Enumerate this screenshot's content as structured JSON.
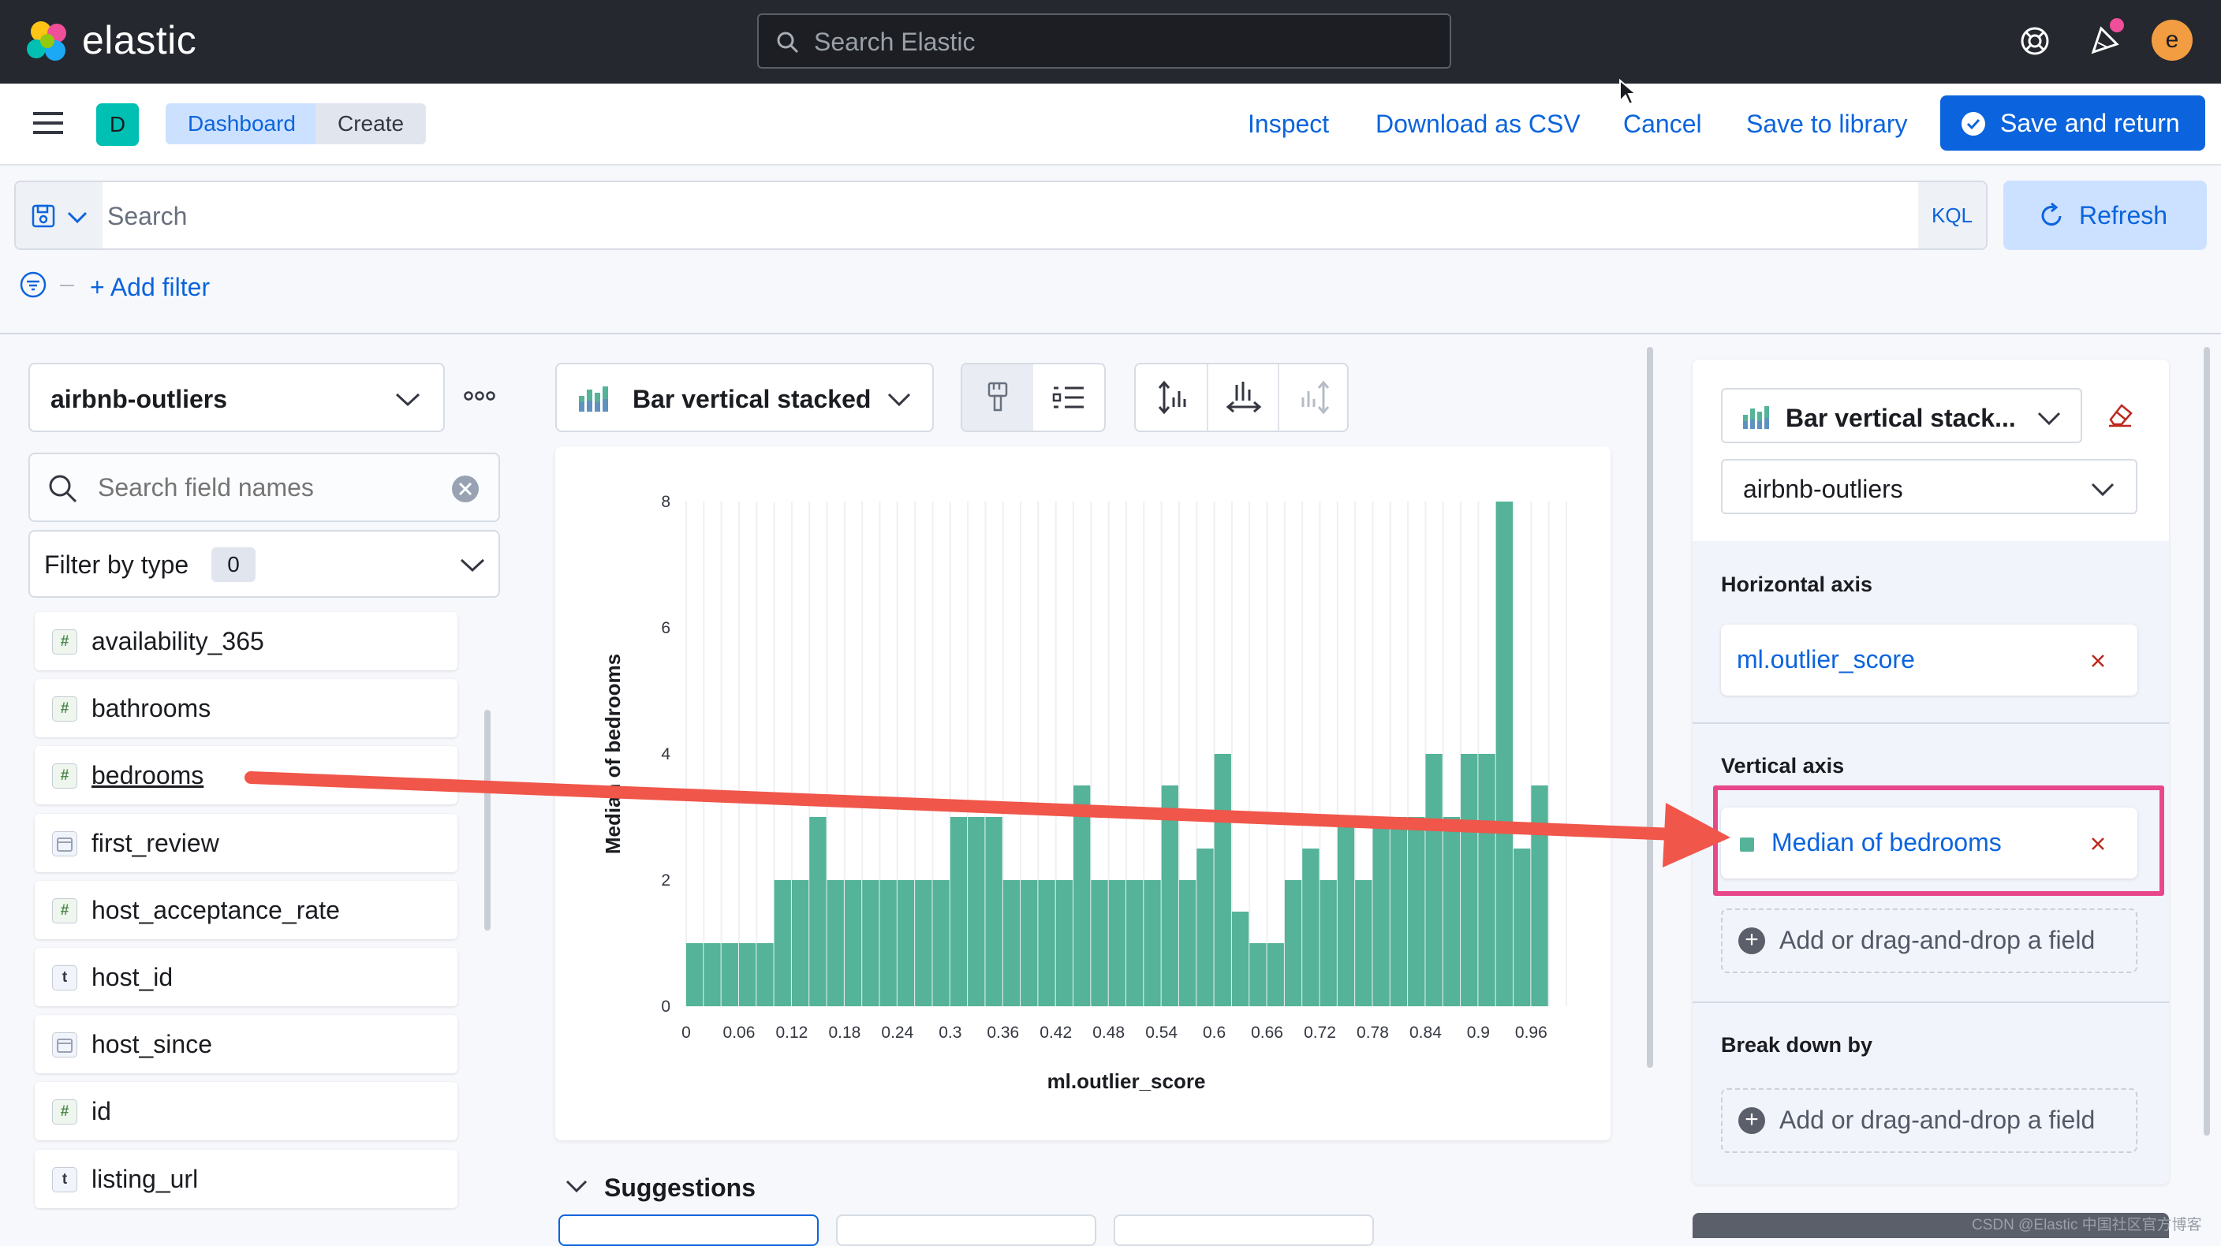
{
  "app": {
    "logo_text": "elastic",
    "user_initial": "e"
  },
  "global_search": {
    "placeholder": "Search Elastic"
  },
  "header": {
    "space_badge": "D",
    "breadcrumbs": [
      "Dashboard",
      "Create"
    ],
    "links": {
      "inspect": "Inspect",
      "download_csv": "Download as CSV",
      "cancel": "Cancel",
      "save_library": "Save to library"
    },
    "save_return": "Save and return"
  },
  "query": {
    "placeholder": "Search",
    "language": "KQL",
    "refresh": "Refresh",
    "add_filter": "+ Add filter"
  },
  "left_panel": {
    "index_pattern": "airbnb-outliers",
    "field_search_placeholder": "Search field names",
    "filter_by_type": "Filter by type",
    "filter_count": "0",
    "fields": [
      {
        "name": "availability_365",
        "type": "#"
      },
      {
        "name": "bathrooms",
        "type": "#"
      },
      {
        "name": "bedrooms",
        "type": "#"
      },
      {
        "name": "first_review",
        "type": "date"
      },
      {
        "name": "host_acceptance_rate",
        "type": "#"
      },
      {
        "name": "host_id",
        "type": "t"
      },
      {
        "name": "host_since",
        "type": "date"
      },
      {
        "name": "id",
        "type": "#"
      },
      {
        "name": "listing_url",
        "type": "t"
      }
    ]
  },
  "workspace": {
    "chart_type": "Bar vertical stacked",
    "suggestions": "Suggestions"
  },
  "right_panel": {
    "chart_type": "Bar vertical stack...",
    "index_pattern": "airbnb-outliers",
    "horizontal_axis_title": "Horizontal axis",
    "horizontal_field": "ml.outlier_score",
    "vertical_axis_title": "Vertical axis",
    "vertical_field": "Median of bedrooms",
    "add_field": "Add or drag-and-drop a field",
    "break_down_title": "Break down by"
  },
  "watermark": "CSDN @Elastic 中国社区官方博客",
  "colors": {
    "accent": "#0b64dd",
    "bar": "#54b399",
    "topbar": "#25282f",
    "highlight": "#e8488b",
    "arrow": "#f0564a"
  },
  "chart_data": {
    "type": "bar",
    "xlabel": "ml.outlier_score",
    "ylabel": "Median of bedrooms",
    "ylim": [
      0,
      8
    ],
    "xlim": [
      0,
      1
    ],
    "bin_width": 0.02,
    "x_ticks": [
      "0",
      "0.06",
      "0.12",
      "0.18",
      "0.24",
      "0.3",
      "0.36",
      "0.42",
      "0.48",
      "0.54",
      "0.6",
      "0.66",
      "0.72",
      "0.78",
      "0.84",
      "0.9",
      "0.96"
    ],
    "y_ticks": [
      "0",
      "2",
      "4",
      "6",
      "8"
    ],
    "x": [
      0,
      0.02,
      0.04,
      0.06,
      0.08,
      0.1,
      0.12,
      0.14,
      0.16,
      0.18,
      0.2,
      0.22,
      0.24,
      0.26,
      0.28,
      0.3,
      0.32,
      0.34,
      0.36,
      0.38,
      0.4,
      0.42,
      0.44,
      0.46,
      0.48,
      0.5,
      0.52,
      0.54,
      0.56,
      0.58,
      0.6,
      0.62,
      0.64,
      0.66,
      0.68,
      0.7,
      0.72,
      0.74,
      0.76,
      0.78,
      0.8,
      0.82,
      0.84,
      0.86,
      0.88,
      0.9,
      0.92,
      0.94,
      0.96,
      0.98
    ],
    "values": [
      1,
      1,
      1,
      1,
      1,
      2,
      2,
      3,
      2,
      2,
      2,
      2,
      2,
      2,
      2,
      3,
      3,
      3,
      2,
      2,
      2,
      2,
      3.5,
      2,
      2,
      2,
      2,
      3.5,
      2,
      2.5,
      4,
      1.5,
      1,
      1,
      2,
      2.5,
      2,
      3,
      2,
      3,
      3,
      3,
      4,
      3,
      4,
      4,
      8,
      2.5,
      3.5,
      0
    ],
    "grid": true,
    "legend": "none"
  }
}
